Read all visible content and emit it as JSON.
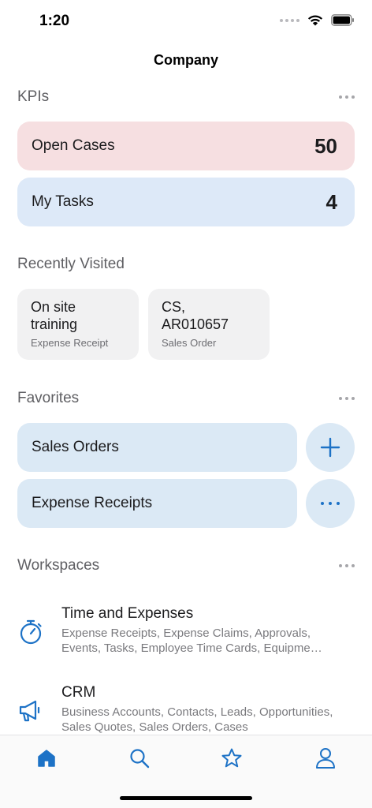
{
  "status_bar": {
    "time": "1:20"
  },
  "header": {
    "title": "Company"
  },
  "kpis": {
    "section_title": "KPIs",
    "items": [
      {
        "label": "Open Cases",
        "value": "50",
        "color": "#f6dfe1"
      },
      {
        "label": "My Tasks",
        "value": "4",
        "color": "#dde9f8"
      }
    ]
  },
  "recently_visited": {
    "section_title": "Recently Visited",
    "items": [
      {
        "title_line1": "On site",
        "title_line2": "training",
        "subtitle": "Expense Receipt"
      },
      {
        "title_line1": "CS,",
        "title_line2": "AR010657",
        "subtitle": "Sales Order"
      }
    ]
  },
  "favorites": {
    "section_title": "Favorites",
    "items": [
      {
        "label": "Sales Orders",
        "action_icon": "plus-icon"
      },
      {
        "label": "Expense Receipts",
        "action_icon": "more-icon"
      }
    ]
  },
  "workspaces": {
    "section_title": "Workspaces",
    "items": [
      {
        "title": "Time and Expenses",
        "description": "Expense Receipts, Expense Claims, Approvals, Events, Tasks, Employee Time Cards, Equipme…",
        "icon": "stopwatch-icon"
      },
      {
        "title": "CRM",
        "description": "Business Accounts, Contacts, Leads, Opportunities, Sales Quotes, Sales Orders, Cases",
        "icon": "megaphone-icon"
      }
    ]
  },
  "tab_bar": {
    "items": [
      {
        "name": "home",
        "icon": "home-icon",
        "active": true
      },
      {
        "name": "search",
        "icon": "search-icon",
        "active": false
      },
      {
        "name": "favorites",
        "icon": "star-icon",
        "active": false
      },
      {
        "name": "profile",
        "icon": "person-icon",
        "active": false
      }
    ]
  },
  "colors": {
    "accent": "#1d72c6",
    "kpi_red_bg": "#f6dfe1",
    "kpi_blue_bg": "#dde9f8",
    "favorite_bg": "#dbe9f5",
    "recent_bg": "#f1f1f2"
  }
}
